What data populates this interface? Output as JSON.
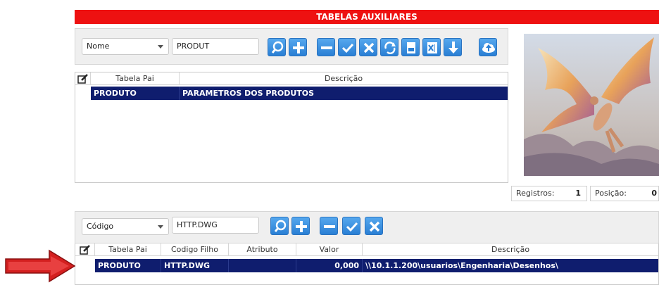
{
  "title": "TABELAS AUXILIARES",
  "top": {
    "filter_select": "Nome",
    "search_value": "PRODUT",
    "toolbar_icons": [
      "search-icon",
      "plus-icon",
      "minus-icon",
      "check-icon",
      "close-icon",
      "refresh-icon",
      "pdf-icon",
      "excel-icon",
      "download-icon",
      "upload-cloud-icon"
    ],
    "columns": [
      "Tabela Pai",
      "Descrição"
    ],
    "rows": [
      {
        "tabela_pai": "PRODUTO",
        "descricao": "PARAMETROS DOS PRODUTOS"
      }
    ]
  },
  "status": {
    "registros_label": "Registros:",
    "registros_value": "1",
    "posicao_label": "Posição:",
    "posicao_value": "0"
  },
  "bottom": {
    "filter_select": "Código",
    "search_value": "HTTP.DWG",
    "toolbar_icons": [
      "search-icon",
      "plus-icon",
      "minus-icon",
      "check-icon",
      "close-icon"
    ],
    "columns": [
      "Tabela Pai",
      "Codigo Filho",
      "Atributo",
      "Valor",
      "Descrição"
    ],
    "rows": [
      {
        "tabela_pai": "PRODUTO",
        "codigo_filho": "HTTP.DWG",
        "atributo": "",
        "valor": "0,000",
        "descricao": "\\\\10.1.1.200\\usuarios\\Engenharia\\Desenhos\\"
      }
    ]
  },
  "colors": {
    "title_bg": "#ee1111",
    "selected_row": "#0f1d6e",
    "button": "#2a7fd4",
    "arrow": "#d42020"
  }
}
